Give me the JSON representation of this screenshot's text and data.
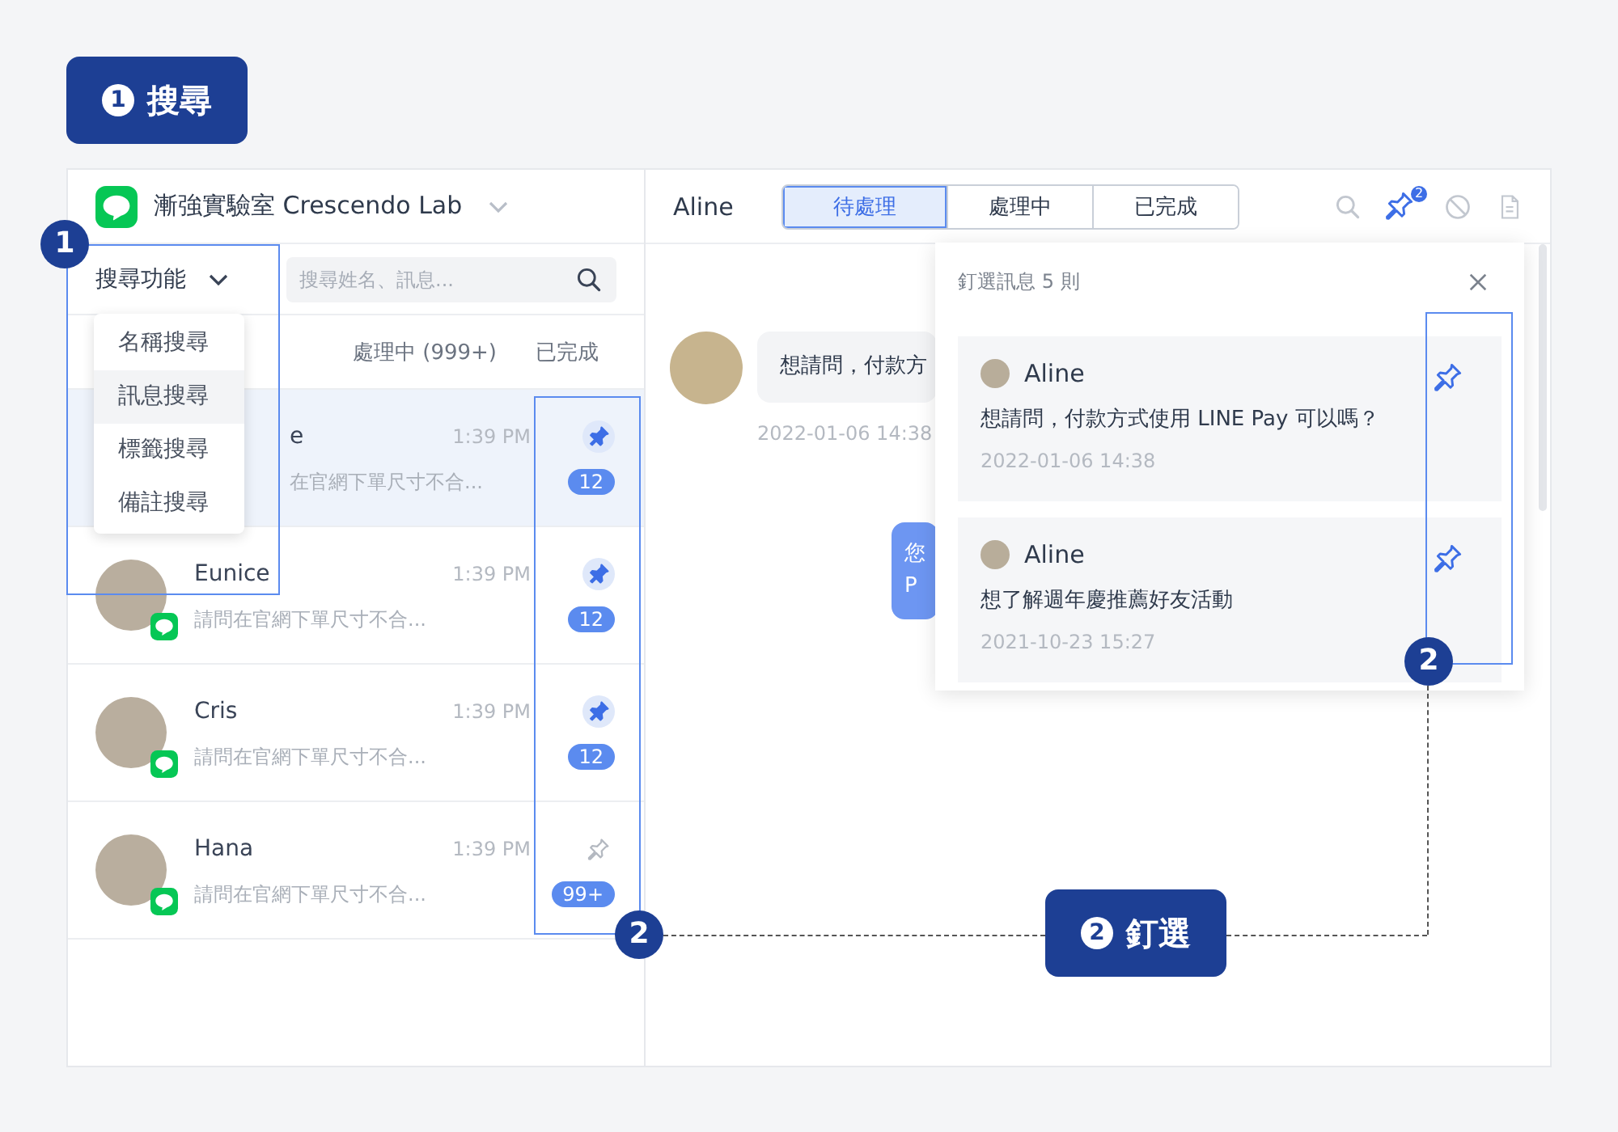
{
  "annotations": {
    "title": {
      "number": "1",
      "label": "搜尋"
    },
    "callout": {
      "number": "2",
      "label": "釘選"
    },
    "markers": [
      {
        "number": "1"
      },
      {
        "number": "2"
      },
      {
        "number": "2"
      }
    ]
  },
  "workspace": {
    "name": "漸強實驗室 Crescendo Lab"
  },
  "search": {
    "mode_label": "搜尋功能",
    "placeholder": "搜尋姓名、訊息..."
  },
  "search_menu": {
    "expanded": true,
    "items": [
      {
        "label": "名稱搜尋",
        "selected": false
      },
      {
        "label": "訊息搜尋",
        "selected": true
      },
      {
        "label": "標籤搜尋",
        "selected": false
      },
      {
        "label": "備註搜尋",
        "selected": false
      }
    ]
  },
  "list_tabs": [
    {
      "label": "處理中 (999+)"
    },
    {
      "label": "已完成"
    }
  ],
  "conversations": [
    {
      "name": "e",
      "time": "1:39 PM",
      "preview": "在官網下單尺寸不合...",
      "unread": "12",
      "pinned": true,
      "selected": true,
      "covered": true
    },
    {
      "name": "Eunice",
      "time": "1:39 PM",
      "preview": "請問在官網下單尺寸不合...",
      "unread": "12",
      "pinned": true,
      "selected": false,
      "covered": false
    },
    {
      "name": "Cris",
      "time": "1:39 PM",
      "preview": "請問在官網下單尺寸不合...",
      "unread": "12",
      "pinned": true,
      "selected": false,
      "covered": false
    },
    {
      "name": "Hana",
      "time": "1:39 PM",
      "preview": "請問在官網下單尺寸不合...",
      "unread": "99+",
      "pinned": false,
      "selected": false,
      "covered": false
    }
  ],
  "chat": {
    "contact": "Aline",
    "status_tabs": [
      {
        "label": "待處理",
        "selected": true
      },
      {
        "label": "處理中",
        "selected": false
      },
      {
        "label": "已完成",
        "selected": false
      }
    ],
    "pin_count": "2",
    "messages": [
      {
        "kind": "incoming",
        "lines": [
          "想請問，付款方"
        ],
        "time": "2022-01-06 14:38"
      },
      {
        "kind": "outgoing",
        "lines": [
          "您",
          "P"
        ]
      }
    ]
  },
  "pinned_panel": {
    "title": "釘選訊息 5 則",
    "items": [
      {
        "sender": "Aline",
        "text": "想請問，付款方式使用 LINE Pay 可以嗎？",
        "time": "2022-01-06 14:38"
      },
      {
        "sender": "Aline",
        "text": "想了解週年慶推薦好友活動",
        "time": "2021-10-23 15:27"
      }
    ]
  }
}
